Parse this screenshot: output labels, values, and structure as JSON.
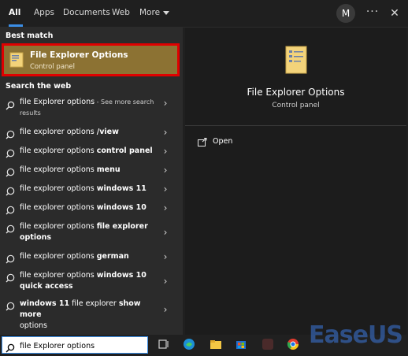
{
  "tabs": [
    {
      "label": "All",
      "active": true
    },
    {
      "label": "Apps"
    },
    {
      "label": "Documents"
    },
    {
      "label": "Web"
    },
    {
      "label": "More"
    }
  ],
  "account_initial": "M",
  "left": {
    "best_match_title": "Best match",
    "best_match": {
      "title": "File Explorer Options",
      "subtitle": "Control panel"
    },
    "web_title": "Search the web",
    "web_items": [
      {
        "prefix": "file Explorer options",
        "bold": "",
        "suffix": " - See more search",
        "suffix2": "results",
        "icon": "search-icon"
      },
      {
        "prefix": "file explorer options ",
        "bold": "/view",
        "icon": "web-search-icon"
      },
      {
        "prefix": "file explorer options ",
        "bold": "control panel",
        "icon": "web-search-icon"
      },
      {
        "prefix": "file explorer options ",
        "bold": "menu",
        "icon": "web-search-icon"
      },
      {
        "prefix": "file explorer options ",
        "bold": "windows 11",
        "icon": "web-search-icon"
      },
      {
        "prefix": "file explorer options ",
        "bold": "windows 10",
        "icon": "web-search-icon"
      },
      {
        "prefix": "file explorer options ",
        "bold": "file explorer",
        "line2": "options",
        "icon": "web-search-icon"
      },
      {
        "prefix": "file explorer options ",
        "bold": "german",
        "icon": "web-search-icon"
      },
      {
        "prefix": "file explorer options ",
        "bold": "windows 10",
        "line2bold": "quick access",
        "icon": "web-search-icon"
      },
      {
        "prefix_bold": "windows 11",
        "prefix": " file explorer ",
        "bold": "show more",
        "line2bold": "options",
        "icon": "web-search-icon"
      }
    ]
  },
  "right": {
    "title": "File Explorer Options",
    "subtitle": "Control panel",
    "action_open": "Open"
  },
  "taskbar": {
    "search_value": "file Explorer options"
  },
  "watermark": "EaseUS",
  "colors": {
    "accent": "#3b8ee6",
    "best_match_bg": "#8c7233",
    "highlight_border": "#e00000",
    "folder": "#f3d37a"
  }
}
